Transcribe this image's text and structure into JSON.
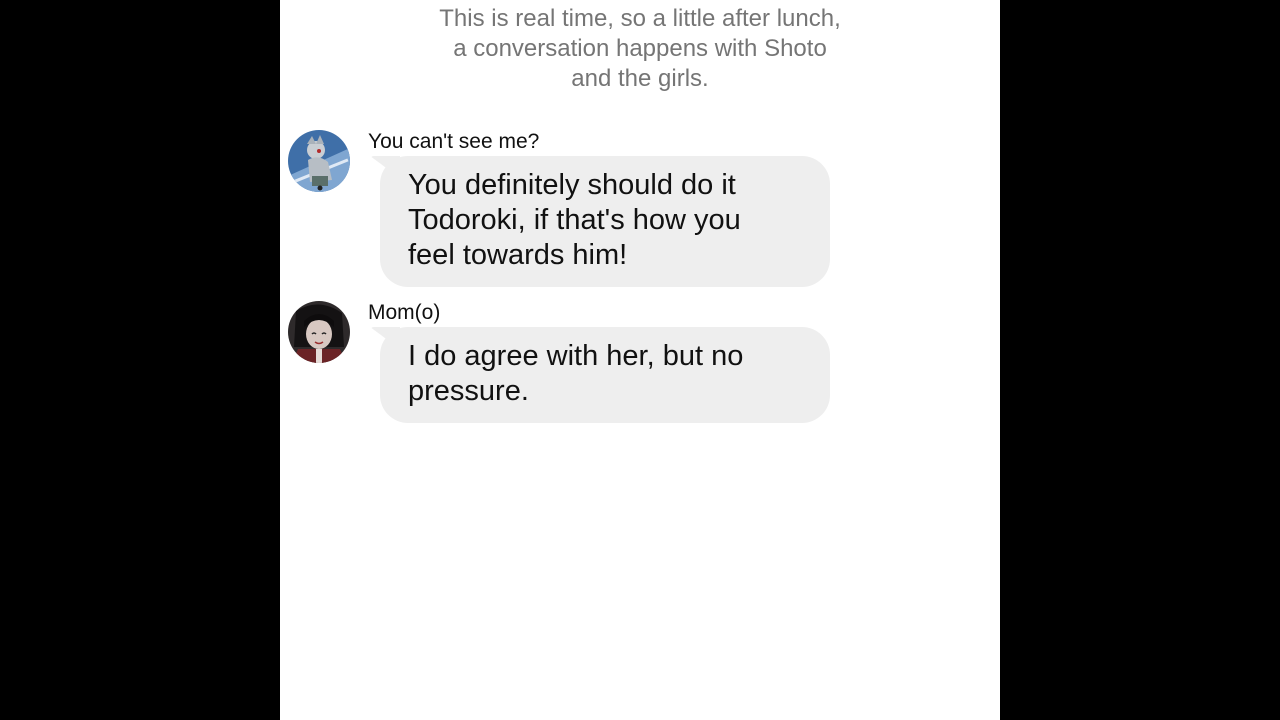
{
  "narration": {
    "lines": [
      "This is real time, so a little after lunch,",
      "a conversation happens with Shoto",
      "and the girls."
    ]
  },
  "messages": [
    {
      "sender": "You can't see me?",
      "avatar_icon": "anime-character-avatar-icon",
      "lines": [
        "You definitely should do it",
        "Todoroki, if that's how you",
        "feel towards him!"
      ]
    },
    {
      "sender": "Mom(o)",
      "avatar_icon": "anime-character-avatar-icon",
      "lines": [
        "I do agree with her, but no",
        "pressure."
      ]
    }
  ],
  "colors": {
    "background": "#000000",
    "screen": "#ffffff",
    "bubble": "#eeeeee",
    "narration_text": "#757575",
    "message_text": "#111111"
  }
}
